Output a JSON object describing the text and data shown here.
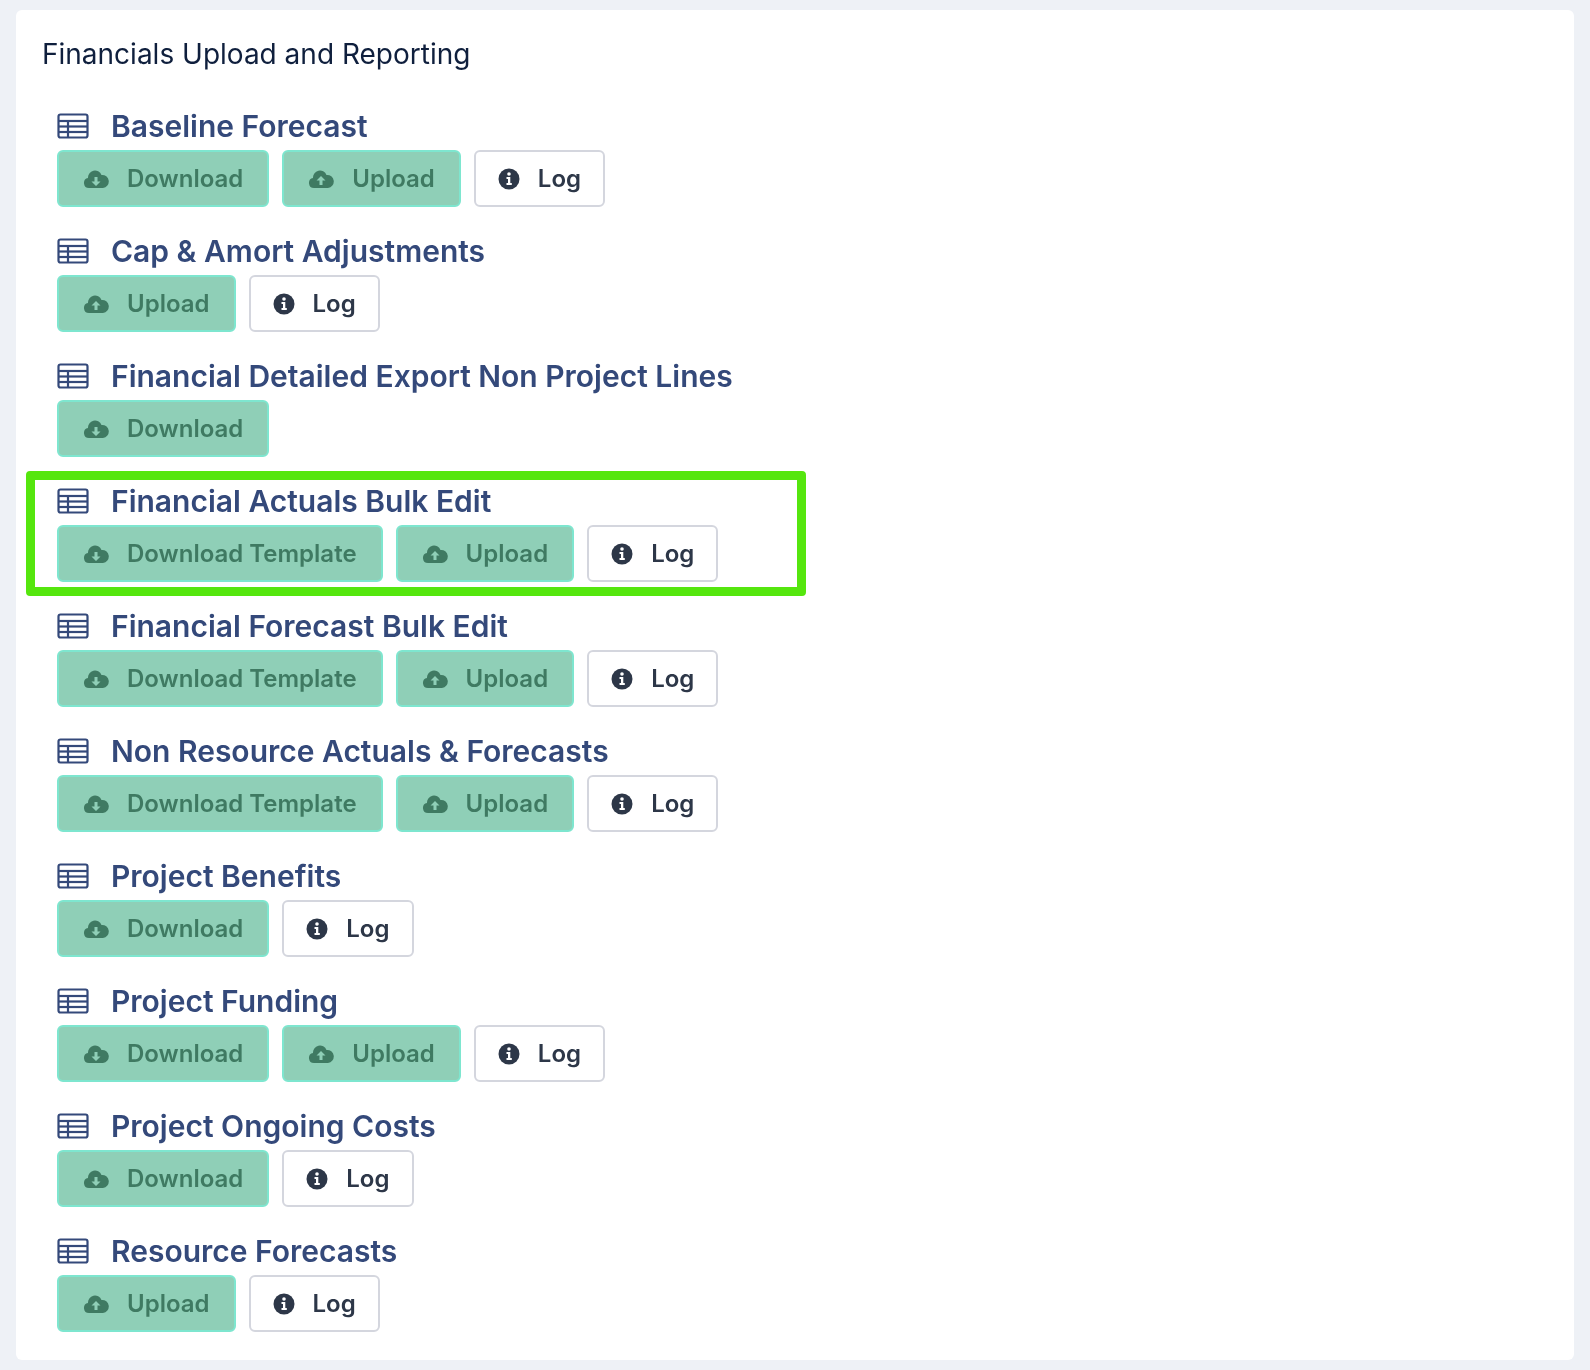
{
  "panel": {
    "title": "Financials Upload and Reporting"
  },
  "sections": [
    {
      "title": "Baseline Forecast",
      "highlighted": false,
      "buttons": [
        {
          "kind": "download",
          "label": "Download"
        },
        {
          "kind": "upload",
          "label": "Upload"
        },
        {
          "kind": "log",
          "label": "Log"
        }
      ]
    },
    {
      "title": "Cap & Amort Adjustments",
      "highlighted": false,
      "buttons": [
        {
          "kind": "upload",
          "label": "Upload"
        },
        {
          "kind": "log",
          "label": "Log"
        }
      ]
    },
    {
      "title": "Financial Detailed Export Non Project Lines",
      "highlighted": false,
      "buttons": [
        {
          "kind": "download",
          "label": "Download"
        }
      ]
    },
    {
      "title": "Financial Actuals Bulk Edit",
      "highlighted": true,
      "buttons": [
        {
          "kind": "download",
          "label": "Download Template"
        },
        {
          "kind": "upload",
          "label": "Upload"
        },
        {
          "kind": "log",
          "label": "Log"
        }
      ]
    },
    {
      "title": "Financial Forecast Bulk Edit",
      "highlighted": false,
      "buttons": [
        {
          "kind": "download",
          "label": "Download Template"
        },
        {
          "kind": "upload",
          "label": "Upload"
        },
        {
          "kind": "log",
          "label": "Log"
        }
      ]
    },
    {
      "title": "Non Resource Actuals & Forecasts",
      "highlighted": false,
      "buttons": [
        {
          "kind": "download",
          "label": "Download Template"
        },
        {
          "kind": "upload",
          "label": "Upload"
        },
        {
          "kind": "log",
          "label": "Log"
        }
      ]
    },
    {
      "title": "Project Benefits",
      "highlighted": false,
      "buttons": [
        {
          "kind": "download",
          "label": "Download"
        },
        {
          "kind": "log",
          "label": "Log"
        }
      ]
    },
    {
      "title": "Project Funding",
      "highlighted": false,
      "buttons": [
        {
          "kind": "download",
          "label": "Download"
        },
        {
          "kind": "upload",
          "label": "Upload"
        },
        {
          "kind": "log",
          "label": "Log"
        }
      ]
    },
    {
      "title": "Project Ongoing Costs",
      "highlighted": false,
      "buttons": [
        {
          "kind": "download",
          "label": "Download"
        },
        {
          "kind": "log",
          "label": "Log"
        }
      ]
    },
    {
      "title": "Resource Forecasts",
      "highlighted": false,
      "buttons": [
        {
          "kind": "upload",
          "label": "Upload"
        },
        {
          "kind": "log",
          "label": "Log"
        }
      ]
    }
  ]
}
